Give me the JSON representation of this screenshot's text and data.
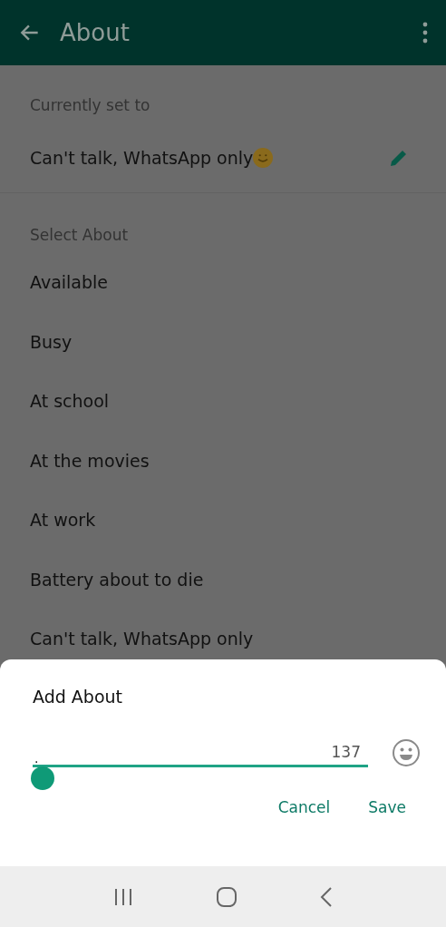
{
  "header": {
    "title": "About"
  },
  "current": {
    "label": "Currently set to",
    "text": "Can't talk, WhatsApp only"
  },
  "select": {
    "label": "Select About",
    "items": [
      "Available",
      "Busy",
      "At school",
      "At the movies",
      "At work",
      "Battery about to die",
      "Can't talk, WhatsApp only"
    ]
  },
  "dialog": {
    "title": "Add About",
    "value": ".",
    "counter": "137",
    "buttons": [
      "Cancel",
      "Save"
    ]
  }
}
